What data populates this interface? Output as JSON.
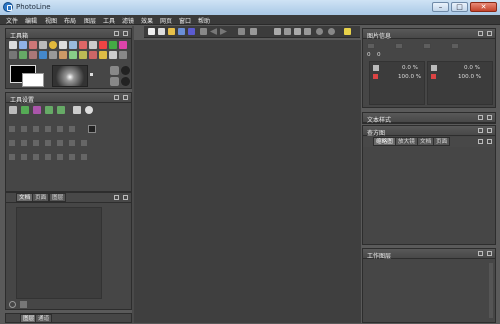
{
  "window": {
    "title": "PhotoLine",
    "minimize": "–",
    "maximize": "□",
    "close": "✕"
  },
  "menu": [
    "文件",
    "编辑",
    "视图",
    "布局",
    "图层",
    "工具",
    "滤镜",
    "效果",
    "网页",
    "窗口",
    "帮助"
  ],
  "panels": {
    "tools": {
      "title": "工具箱"
    },
    "tool_settings": {
      "title": "工具设置"
    },
    "doc_tabs": [
      "文档",
      "页面",
      "图层"
    ],
    "bottom_left": [
      "图层",
      "通道"
    ],
    "image_info": {
      "title": "图片信息"
    },
    "info_values": {
      "pos_x": "0",
      "pos_y": "0",
      "w_label": "0",
      "row1_pct_left": "0.0 %",
      "row2_pct_left": "100.0 %",
      "row1_pct_right": "0.0 %",
      "row2_pct_right": "100.0 %"
    },
    "text_style": {
      "title": "文本样式"
    },
    "browser": {
      "title": "查方图"
    },
    "browser_tabs": [
      "缩略图",
      "放大镜",
      "文档",
      "页面"
    ],
    "work_layers": {
      "title": "工作图层"
    }
  },
  "colors": {
    "accent": "#2b77c7",
    "panel_bg": "#464646",
    "canvas_bg": "#3f3f3f"
  }
}
